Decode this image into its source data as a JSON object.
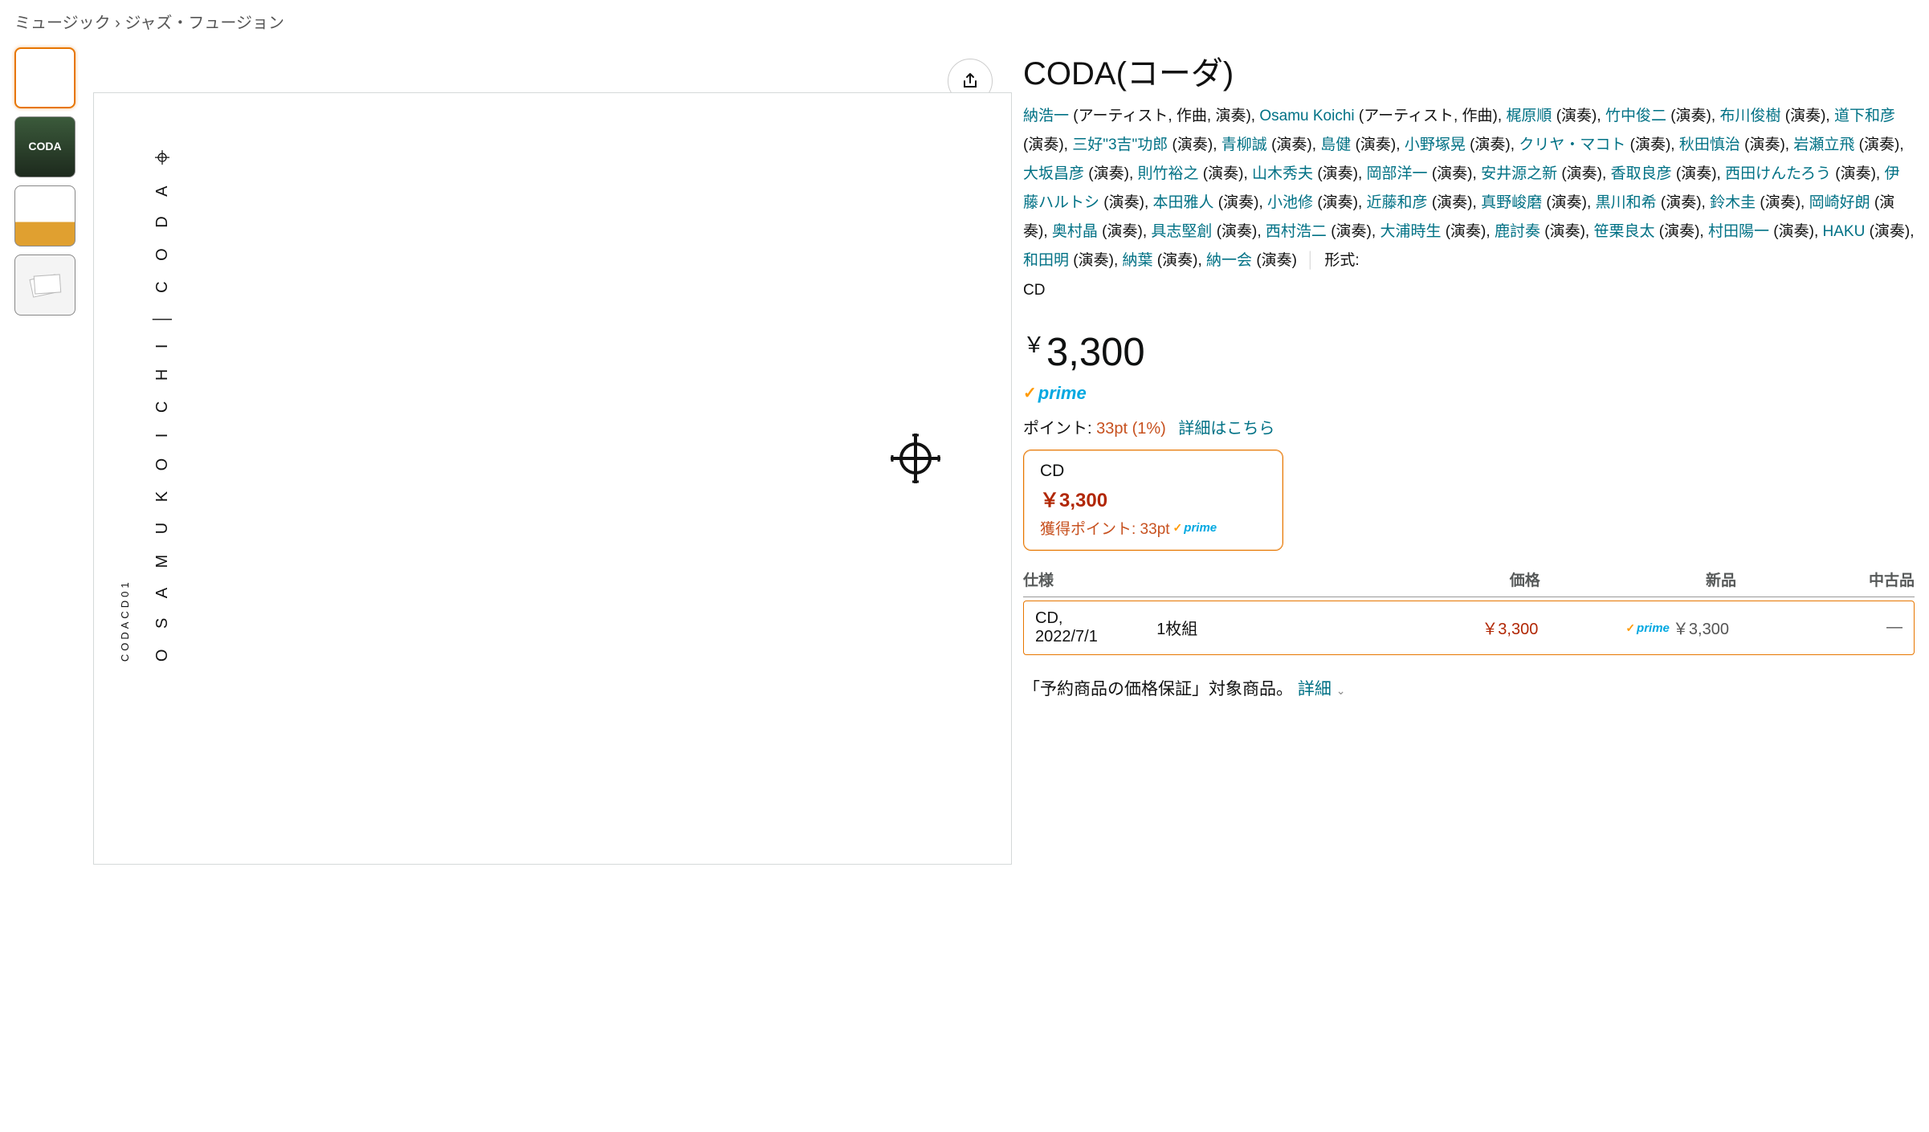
{
  "breadcrumb": {
    "cat1": "ミュージック",
    "sep": "›",
    "cat2": "ジャズ・フュージョン"
  },
  "product": {
    "title": "CODA(コーダ)",
    "spine_artist": "O S A M U   K O I C H I",
    "spine_title": "C O D A",
    "spine_catno": "CODACD01",
    "format_label": "形式:",
    "format_value": "CD",
    "contributors": [
      {
        "name": "納浩一",
        "roles": "アーティスト, 作曲, 演奏"
      },
      {
        "name": "Osamu Koichi",
        "roles": "アーティスト, 作曲"
      },
      {
        "name": "梶原順",
        "roles": "演奏"
      },
      {
        "name": "竹中俊二",
        "roles": "演奏"
      },
      {
        "name": "布川俊樹",
        "roles": "演奏"
      },
      {
        "name": "道下和彦",
        "roles": "演奏"
      },
      {
        "name": "三好\"3吉\"功郎",
        "roles": "演奏"
      },
      {
        "name": "青柳誠",
        "roles": "演奏"
      },
      {
        "name": "島健",
        "roles": "演奏"
      },
      {
        "name": "小野塚晃",
        "roles": "演奏"
      },
      {
        "name": "クリヤ・マコト",
        "roles": "演奏"
      },
      {
        "name": "秋田慎治",
        "roles": "演奏"
      },
      {
        "name": "岩瀬立飛",
        "roles": "演奏"
      },
      {
        "name": "大坂昌彦",
        "roles": "演奏"
      },
      {
        "name": "則竹裕之",
        "roles": "演奏"
      },
      {
        "name": "山木秀夫",
        "roles": "演奏"
      },
      {
        "name": "岡部洋一",
        "roles": "演奏"
      },
      {
        "name": "安井源之新",
        "roles": "演奏"
      },
      {
        "name": "香取良彦",
        "roles": "演奏"
      },
      {
        "name": "西田けんたろう",
        "roles": "演奏"
      },
      {
        "name": "伊藤ハルトシ",
        "roles": "演奏"
      },
      {
        "name": "本田雅人",
        "roles": "演奏"
      },
      {
        "name": "小池修",
        "roles": "演奏"
      },
      {
        "name": "近藤和彦",
        "roles": "演奏"
      },
      {
        "name": "真野峻磨",
        "roles": "演奏"
      },
      {
        "name": "黒川和希",
        "roles": "演奏"
      },
      {
        "name": "鈴木圭",
        "roles": "演奏"
      },
      {
        "name": "岡崎好朗",
        "roles": "演奏"
      },
      {
        "name": "奥村晶",
        "roles": "演奏"
      },
      {
        "name": "具志堅創",
        "roles": "演奏"
      },
      {
        "name": "西村浩二",
        "roles": "演奏"
      },
      {
        "name": "大浦時生",
        "roles": "演奏"
      },
      {
        "name": "鹿討奏",
        "roles": "演奏"
      },
      {
        "name": "笹栗良太",
        "roles": "演奏"
      },
      {
        "name": "村田陽一",
        "roles": "演奏"
      },
      {
        "name": "HAKU",
        "roles": "演奏"
      },
      {
        "name": "和田明",
        "roles": "演奏"
      },
      {
        "name": "納葉",
        "roles": "演奏"
      },
      {
        "name": "納一会",
        "roles": "演奏"
      }
    ]
  },
  "pricing": {
    "currency": "￥",
    "price": "3,300",
    "prime": "prime",
    "points_label": "ポイント:",
    "points_value": "33pt  (1%)",
    "points_detail_link": "詳細はこちら",
    "format_card": {
      "format": "CD",
      "price": "￥3,300",
      "earn_label": "獲得ポイント: 33pt"
    }
  },
  "spec": {
    "headers": {
      "spec": "仕様",
      "price": "価格",
      "new": "新品",
      "used": "中古品"
    },
    "row": {
      "format": "CD,",
      "date": "2022/7/1",
      "discs": "1枚組",
      "price": "￥3,300",
      "new_price": "￥3,300",
      "used": "—"
    }
  },
  "preorder": {
    "text": "「予約商品の価格保証」対象商品。",
    "link": "詳細"
  },
  "thumbs": {
    "t2_line1": "CODA"
  }
}
